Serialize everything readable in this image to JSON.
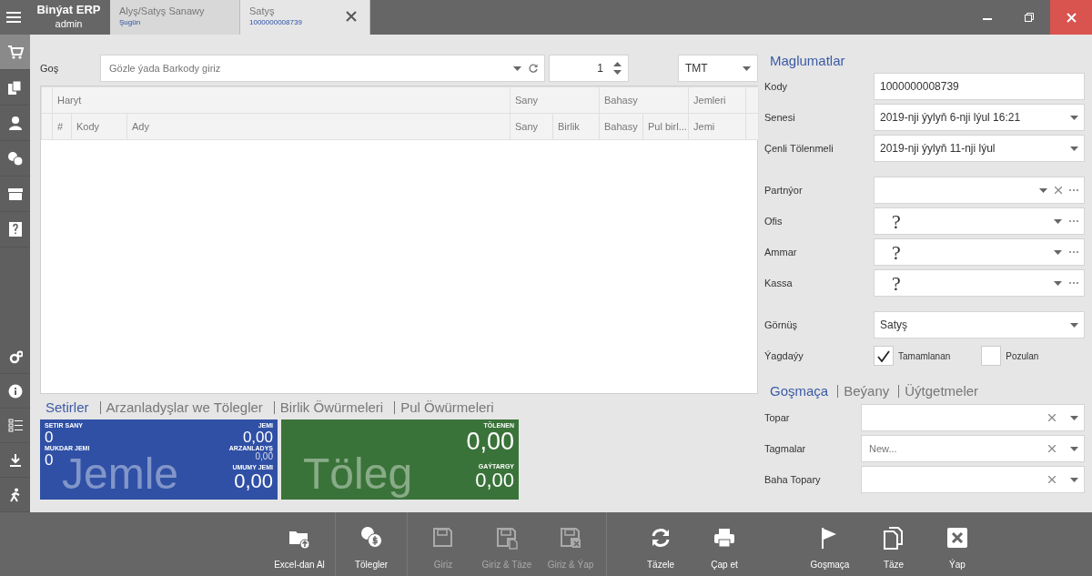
{
  "window": {
    "app_name": "Binýat ERP",
    "user": "admin"
  },
  "tabs": [
    {
      "title": "Alyş/Satyş Sanawy",
      "subtitle": "Şugün",
      "selected": false,
      "closable": false
    },
    {
      "title": "Satyş",
      "subtitle": "1000000008739",
      "selected": true,
      "closable": true
    }
  ],
  "sidebar": {
    "top_items": [
      {
        "selected": true
      },
      {
        "selected": false
      },
      {
        "selected": false
      },
      {
        "selected": false
      },
      {
        "selected": false
      },
      {
        "selected": false
      }
    ],
    "bottom_items": [
      {
        "selected": false
      },
      {
        "selected": false
      },
      {
        "selected": false
      },
      {
        "selected": false
      },
      {
        "selected": false
      }
    ]
  },
  "entry": {
    "label": "Goş",
    "placeholder": "Gözle ýada Barkody giriz",
    "quantity": "1",
    "currency": "TMT"
  },
  "grid": {
    "groups": [
      {
        "label": "Haryt",
        "columns": [
          "#",
          "Kody",
          "Ady"
        ]
      },
      {
        "label": "Sany",
        "columns": [
          "Sany",
          "Birlik"
        ]
      },
      {
        "label": "Bahasy",
        "columns": [
          "Bahasy",
          "Pul birl..."
        ]
      },
      {
        "label": "Jemleri",
        "columns": [
          "Jemi"
        ]
      }
    ]
  },
  "summary_tabs": [
    {
      "label": "Setirler",
      "selected": true
    },
    {
      "label": "Arzanladyşlar we Tölegler",
      "selected": false
    },
    {
      "label": "Birlik Öwürmeleri",
      "selected": false
    },
    {
      "label": "Pul Öwürmeleri",
      "selected": false
    }
  ],
  "totals_card": {
    "watermark": "Jemle",
    "left": [
      {
        "label": "SETIR SANY",
        "value": "0"
      },
      {
        "label": "MUKDAR JEMI",
        "value": "0"
      }
    ],
    "right": [
      {
        "label": "JEMI",
        "value": "0,00"
      },
      {
        "label": "ARZANLADYŞ",
        "value": "0,00"
      },
      {
        "label": "UMUMY JEMI",
        "value": "0,00"
      }
    ]
  },
  "payment_card": {
    "watermark": "Töleg",
    "right": [
      {
        "label": "TÖLENEN",
        "value": "0,00"
      },
      {
        "label": "GAÝTARGY",
        "value": "0,00"
      }
    ]
  },
  "details": {
    "title": "Maglumatlar",
    "groups": [
      [
        {
          "kind": "text",
          "label": "Kody",
          "value": "1000000008739"
        },
        {
          "kind": "select",
          "label": "Senesi",
          "value": "2019-nji ýylyň 6-nji lýul 16:21"
        },
        {
          "kind": "select",
          "label": "Çenli Tölenmeli",
          "value": "2019-nji ýylyň 11-nji lýul"
        }
      ],
      [
        {
          "kind": "lookup",
          "label": "Partnýor",
          "clearable": true
        },
        {
          "kind": "lookup",
          "label": "Ofis",
          "value": "?",
          "clearable": false
        },
        {
          "kind": "lookup",
          "label": "Ammar",
          "value": "?",
          "clearable": false
        },
        {
          "kind": "lookup",
          "label": "Kassa",
          "value": "?",
          "clearable": false
        }
      ],
      [
        {
          "kind": "select",
          "label": "Görnüş",
          "value": "Satyş"
        },
        {
          "kind": "checks",
          "label": "Ýagdaýy",
          "options": [
            {
              "label": "Tamamlanan",
              "checked": true
            },
            {
              "label": "Pozulan",
              "checked": false
            }
          ]
        }
      ]
    ]
  },
  "extra_tabs": [
    {
      "label": "Goşmaça",
      "selected": true
    },
    {
      "label": "Beýany",
      "selected": false
    },
    {
      "label": "Üýtgetmeler",
      "selected": false
    }
  ],
  "extra_fields": [
    {
      "label": "Topar"
    },
    {
      "label": "Tagmalar",
      "placeholder": "New..."
    },
    {
      "label": "Baha Topary"
    }
  ],
  "toolbar": [
    [
      {
        "label": "Excel-dan Al",
        "disabled": false
      }
    ],
    [
      {
        "label": "Tölegler",
        "disabled": false
      }
    ],
    [
      {
        "label": "Giriz",
        "disabled": true
      },
      {
        "label": "Giriz & Täze",
        "disabled": true
      },
      {
        "label": "Giriz & Ýap",
        "disabled": true
      }
    ],
    [
      {
        "label": "Täzele",
        "disabled": false
      },
      {
        "label": "Çap et",
        "disabled": false
      },
      {
        "label": "Goşmaça",
        "disabled": false
      },
      {
        "label": "Täze",
        "disabled": false
      },
      {
        "label": "Ýap",
        "disabled": false
      }
    ]
  ]
}
